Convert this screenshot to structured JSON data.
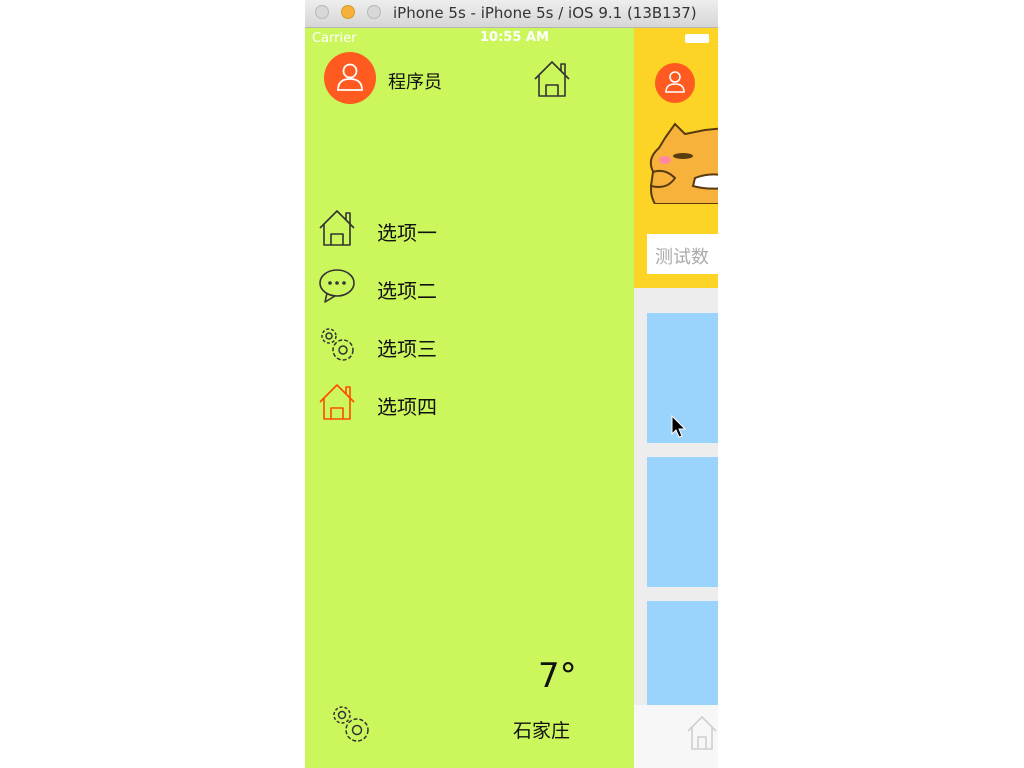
{
  "window": {
    "title": "iPhone 5s - iPhone 5s / iOS 9.1 (13B137)"
  },
  "status_bar": {
    "carrier": "Carrier",
    "time": "10:55 AM"
  },
  "drawer": {
    "username": "程序员",
    "menu": [
      {
        "label": "选项一",
        "icon": "home-icon"
      },
      {
        "label": "选项二",
        "icon": "chat-bubble-icon"
      },
      {
        "label": "选项三",
        "icon": "gears-icon"
      },
      {
        "label": "选项四",
        "icon": "home-icon",
        "highlight": "#ff4a00"
      }
    ],
    "weather": {
      "temperature": "7°",
      "city": "石家庄"
    }
  },
  "main": {
    "search_placeholder": "测试数"
  },
  "colors": {
    "drawer_bg": "#ccf75c",
    "avatar_bg": "#ff5a1f",
    "header_bg": "#fdd426",
    "card_bg": "#9ad3fb",
    "highlight_icon": "#ff4a00"
  }
}
